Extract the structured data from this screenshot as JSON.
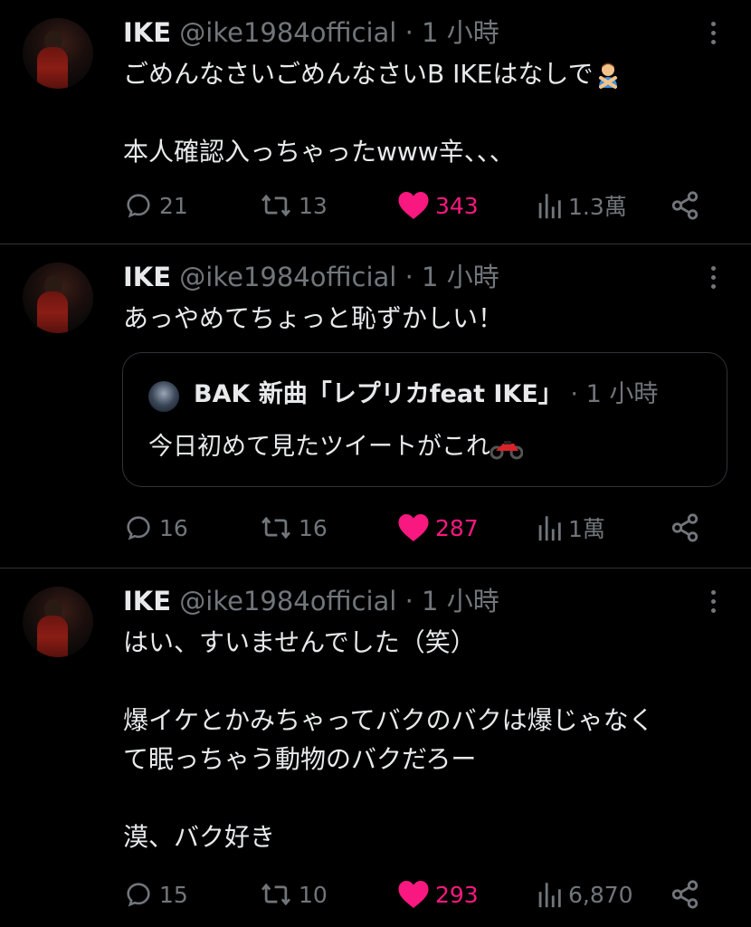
{
  "tweets": [
    {
      "name": "IKE",
      "handle": "@ike1984official",
      "dot": "·",
      "time": "1 小時",
      "lines": [
        "ごめんなさいごめんなさいB IKEはなしで",
        "",
        "本人確認入っちゃったwww辛、、、"
      ],
      "emoji": "person-gesturing-no-emoji",
      "replies": "21",
      "retweets": "13",
      "likes": "343",
      "views": "1.3萬"
    },
    {
      "name": "IKE",
      "handle": "@ike1984official",
      "dot": "·",
      "time": "1 小時",
      "lines": [
        "あっやめてちょっと恥ずかしい！"
      ],
      "quote": {
        "name": "BAK 新曲「レプリカfeat IKE」",
        "dot": "·",
        "time": "1 小時",
        "text": "今日初めて見たツイートがこれ",
        "emoji": "motorcycle-emoji"
      },
      "replies": "16",
      "retweets": "16",
      "likes": "287",
      "views": "1萬"
    },
    {
      "name": "IKE",
      "handle": "@ike1984official",
      "dot": "·",
      "time": "1 小時",
      "lines": [
        "はい、すいませんでした（笑）",
        "",
        "爆イケとかみちゃってバクのバクは爆じゃなく",
        "て眠っちゃう動物のバクだろー",
        "",
        "漠、バク好き"
      ],
      "replies": "15",
      "retweets": "10",
      "likes": "293",
      "views": "6,870"
    }
  ],
  "colors": {
    "background": "#000000",
    "text": "#e7e9ea",
    "muted": "#71767b",
    "like": "#f91880",
    "border": "#2f3336"
  }
}
